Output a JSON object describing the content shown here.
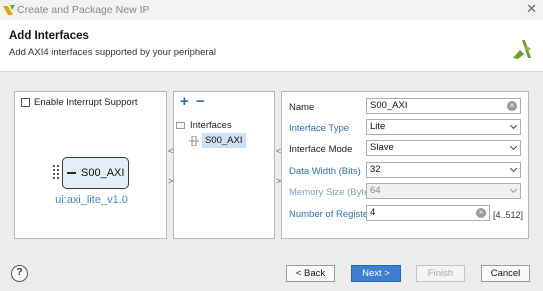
{
  "window": {
    "title": "Create and Package New IP",
    "close_icon": "close-icon",
    "logo_icon": "vivado-logo-icon"
  },
  "header": {
    "title": "Add Interfaces",
    "subtitle": "Add AXI4 interfaces supported by your peripheral"
  },
  "left_panel": {
    "interrupt_checkbox": {
      "label": "Enable Interrupt Support",
      "checked": false
    },
    "ip_block": {
      "interface_name": "S00_AXI",
      "component_name": "ui:axi_lite_v1.0"
    }
  },
  "middle_panel": {
    "add_label": "+",
    "remove_label": "−",
    "tree_root": "Interfaces",
    "tree_items": [
      {
        "label": "S00_AXI",
        "selected": true
      }
    ]
  },
  "nav_arrows": {
    "left": "<",
    "right": ">"
  },
  "form": {
    "name": {
      "label": "Name",
      "value": "S00_AXI"
    },
    "interface_type": {
      "label": "Interface Type",
      "value": "Lite"
    },
    "interface_mode": {
      "label": "Interface Mode",
      "value": "Slave"
    },
    "data_width": {
      "label": "Data Width (Bits)",
      "value": "32"
    },
    "memory_size": {
      "label": "Memory Size (Bytes)",
      "value": "64",
      "disabled": true
    },
    "num_registers": {
      "label": "Number of Registers",
      "value": "4",
      "range": "[4..512]"
    }
  },
  "footer": {
    "help_label": "?",
    "back_label": "< Back",
    "next_label": "Next >",
    "finish_label": "Finish",
    "cancel_label": "Cancel"
  },
  "colors": {
    "accent": "#3d7fd1",
    "link_blue": "#2f6fb0",
    "ip_label": "#4a88c7",
    "selection": "#cfe1f3"
  }
}
